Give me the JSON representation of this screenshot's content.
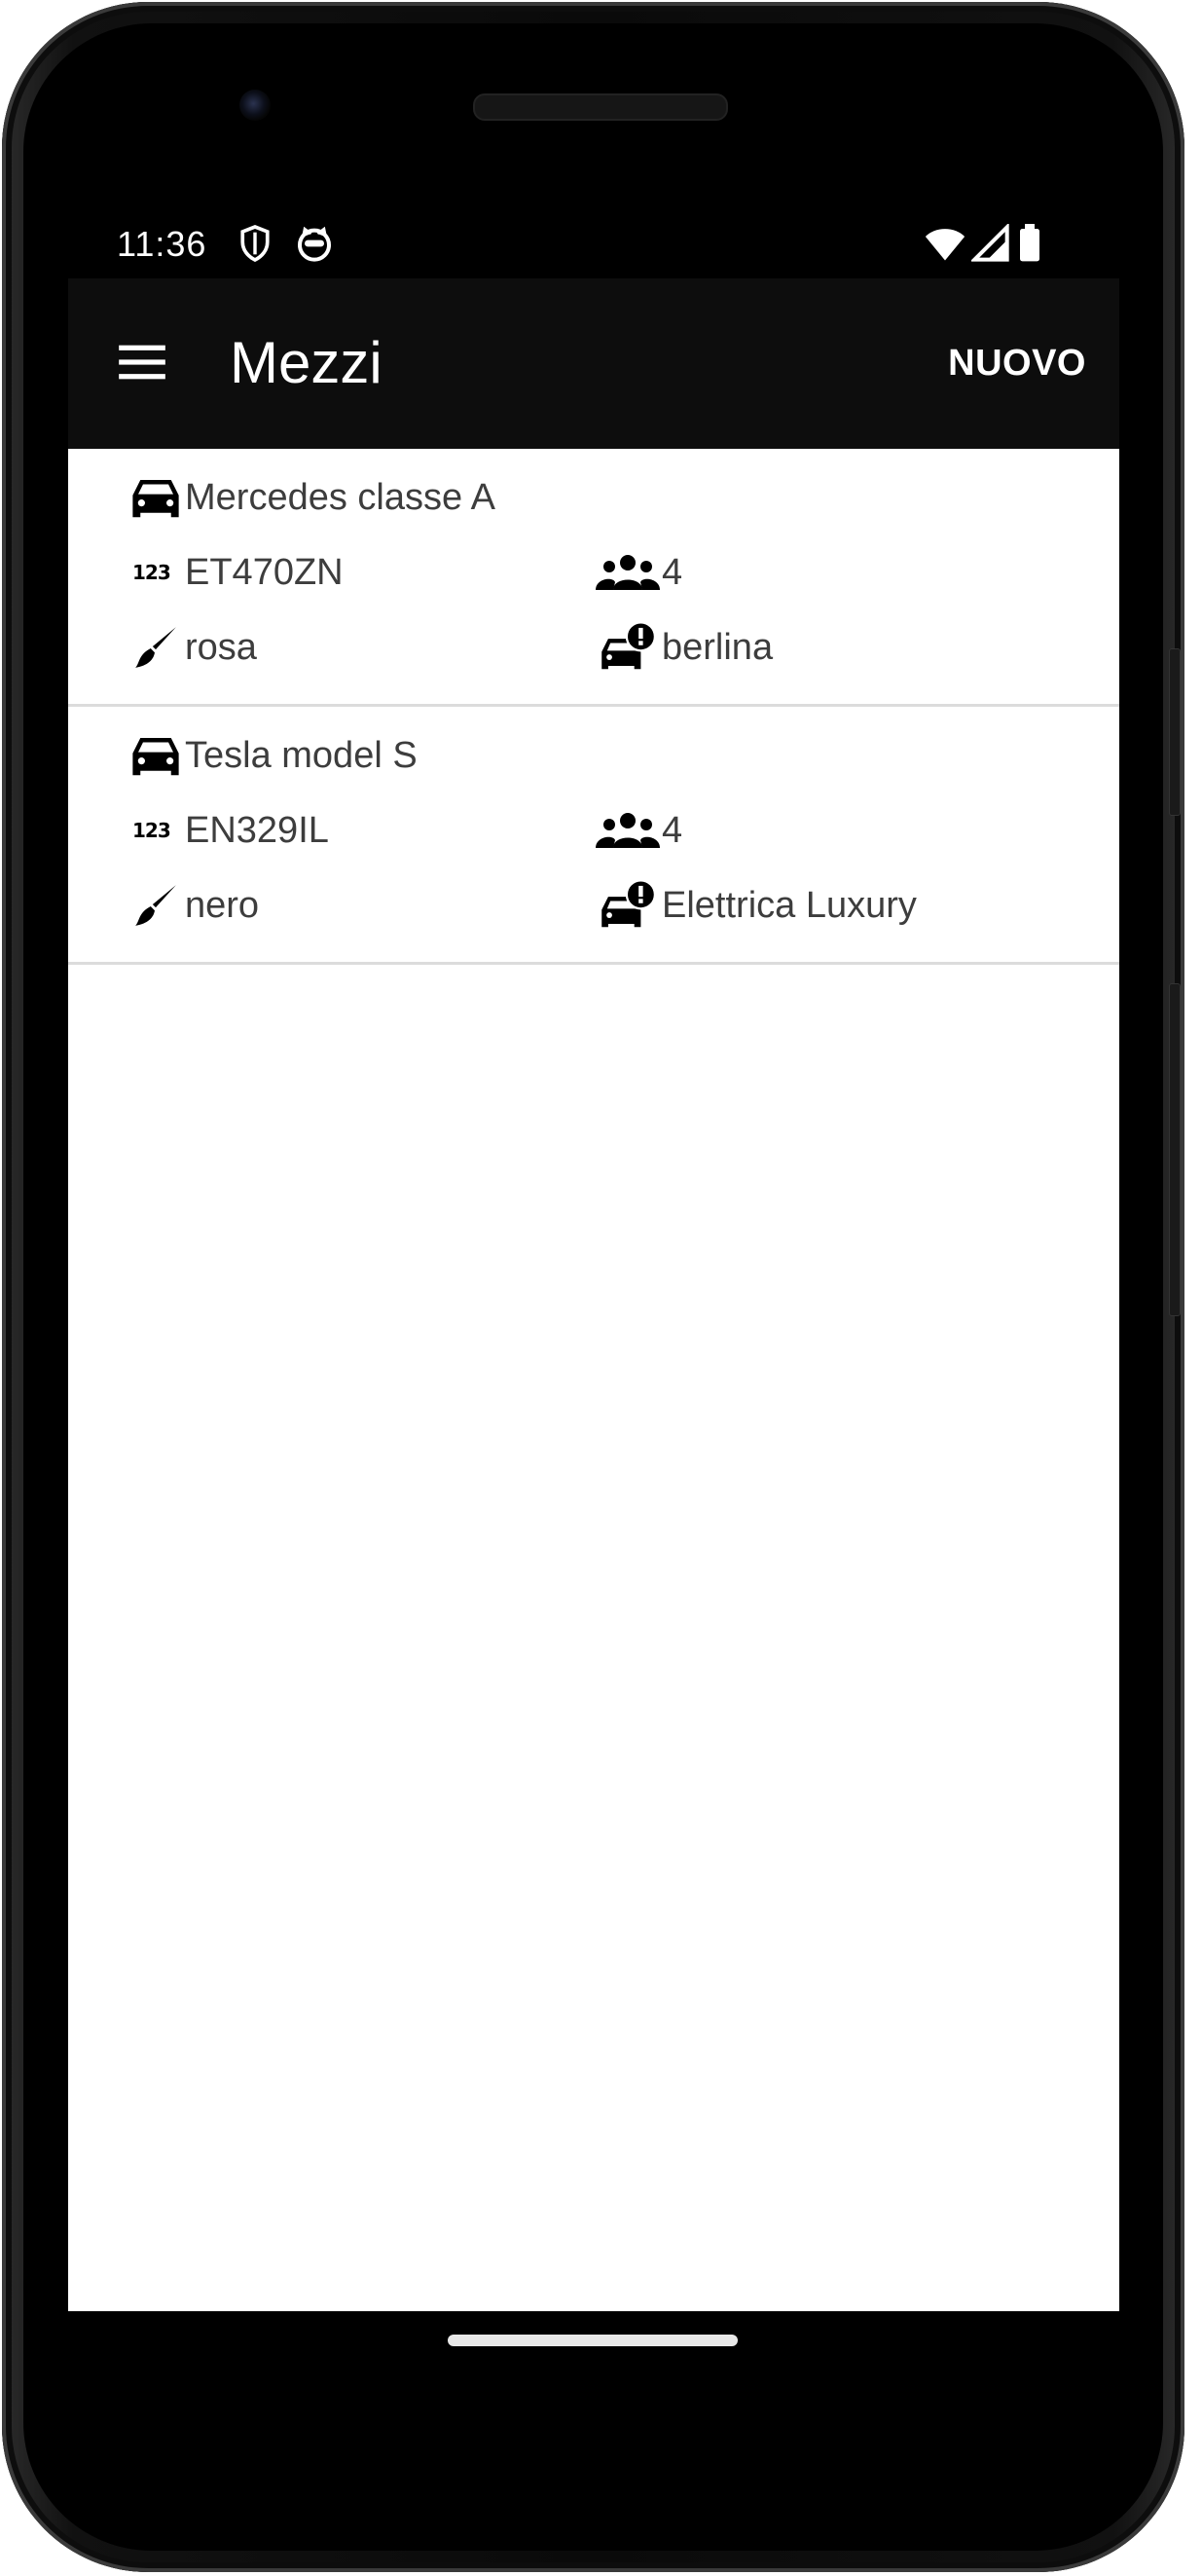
{
  "status_bar": {
    "time": "11:36",
    "icons": [
      "shield-icon",
      "cat-face-icon",
      "wifi-icon",
      "signal-icon",
      "battery-icon"
    ]
  },
  "app_bar": {
    "title": "Mezzi",
    "action_label": "NUOVO",
    "menu_icon": "hamburger-menu-icon"
  },
  "vehicles": [
    {
      "name": "Mercedes classe A",
      "plate": "ET470ZN",
      "seats": "4",
      "color": "rosa",
      "type": "berlina"
    },
    {
      "name": "Tesla model S",
      "plate": "EN329IL",
      "seats": "4",
      "color": "nero",
      "type": "Elettrica Luxury"
    }
  ],
  "colors": {
    "app_bar_bg": "#0d0d0d",
    "text": "#3d3d3d",
    "divider": "#dcdcdc"
  }
}
